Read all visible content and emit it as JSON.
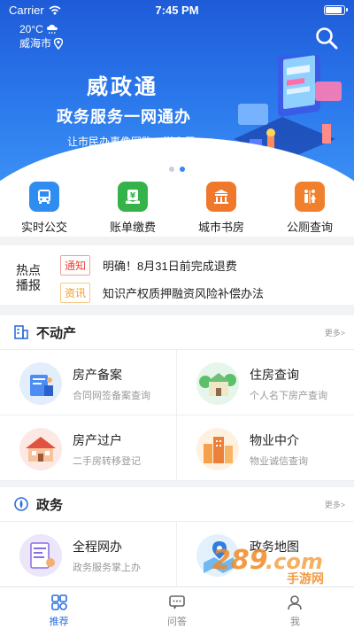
{
  "status_bar": {
    "carrier": "Carrier",
    "time": "7:45 PM",
    "battery_level": 0.9
  },
  "weather": {
    "temperature": "20°C",
    "city": "威海市"
  },
  "banner": {
    "brand": "威政通",
    "slogan": "政务服务一网通办",
    "sub_slogan": "让市民办事像网购一样方便",
    "pager": {
      "count": 2,
      "active_index": 1
    }
  },
  "quick_services": [
    {
      "label": "实时公交",
      "icon": "bus-icon",
      "color": "#2f8cf0"
    },
    {
      "label": "账单缴费",
      "icon": "bill-payment-icon",
      "color": "#35b24a"
    },
    {
      "label": "城市书房",
      "icon": "library-icon",
      "color": "#f0782b"
    },
    {
      "label": "公厕查询",
      "icon": "toilet-icon",
      "color": "#f0802b"
    }
  ],
  "news": {
    "heading": "热点播报",
    "items": [
      {
        "tag": "通知",
        "text": "明确！8月31日前完成退费"
      },
      {
        "tag": "资讯",
        "text": "知识产权质押融资风险补偿办法"
      }
    ]
  },
  "real_estate": {
    "title": "不动产",
    "more": "更多>",
    "items": [
      {
        "title": "房产备案",
        "desc": "合同网签备案查询"
      },
      {
        "title": "住房查询",
        "desc": "个人名下房产查询"
      },
      {
        "title": "房产过户",
        "desc": "二手房转移登记"
      },
      {
        "title": "物业中介",
        "desc": "物业诚信查询"
      }
    ]
  },
  "government": {
    "title": "政务",
    "more": "更多>",
    "items": [
      {
        "title": "全程网办",
        "desc": "政务服务掌上办"
      },
      {
        "title": "政务地图",
        "desc": ""
      }
    ]
  },
  "tab_bar": [
    {
      "label": "推荐",
      "icon": "recommend-icon",
      "active": true
    },
    {
      "label": "问答",
      "icon": "qa-icon",
      "active": false
    },
    {
      "label": "我",
      "icon": "profile-icon",
      "active": false
    }
  ],
  "watermark": "289.com 手游网",
  "colors": {
    "accent": "#2b6fe0",
    "banner": "#2b78ec",
    "notice": "#e8453c",
    "info": "#f59a23"
  }
}
